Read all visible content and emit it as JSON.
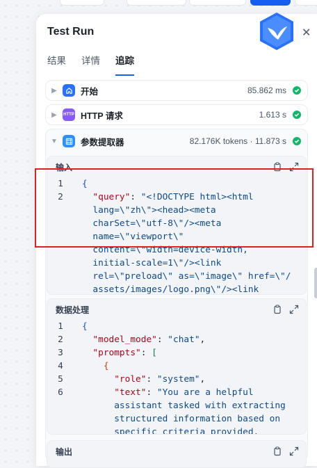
{
  "panel": {
    "title": "Test Run",
    "tabs": [
      {
        "label": "结果",
        "active": false
      },
      {
        "label": "详情",
        "active": false
      },
      {
        "label": "追踪",
        "active": true
      }
    ]
  },
  "colors": {
    "accent": "#155eef",
    "success": "#12b76a",
    "highlight": "#e02020"
  },
  "nodes": [
    {
      "name": "开始",
      "icon": "home-icon",
      "meta": "85.862 ms",
      "status": "success"
    },
    {
      "name": "HTTP 请求",
      "icon": "http-icon",
      "icon_text": "HTTP",
      "meta": "1.613 s",
      "status": "success"
    },
    {
      "name": "参数提取器",
      "icon": "parameter-extractor-icon",
      "meta": "82.176K tokens · 11.873 s",
      "status": "success"
    }
  ],
  "sections": {
    "input": {
      "label": "输入",
      "line_numbers": [
        "1",
        "2"
      ],
      "lines": [
        [
          {
            "t": "{",
            "c": "br1"
          }
        ],
        [
          {
            "t": "  \"query\"",
            "c": "key"
          },
          {
            "t": ": ",
            "c": "pun"
          },
          {
            "t": "\"<!DOCTYPE html><html",
            "c": "str"
          }
        ],
        [
          {
            "t": "  lang=\\\"zh\\\"><head><meta",
            "c": "str"
          }
        ],
        [
          {
            "t": "  charSet=\\\"utf-8\\\"/><meta",
            "c": "str"
          }
        ],
        [
          {
            "t": "  name=\\\"viewport\\\"",
            "c": "str"
          }
        ],
        [
          {
            "t": "  content=\\\"width=device-width,",
            "c": "str"
          }
        ],
        [
          {
            "t": "  initial-scale=1\\\"/><link",
            "c": "str"
          }
        ],
        [
          {
            "t": "  rel=\\\"preload\\\" as=\\\"image\\\" href=\\\"/",
            "c": "str"
          }
        ],
        [
          {
            "t": "  assets/images/logo.png\\\"/><link",
            "c": "str"
          }
        ]
      ]
    },
    "data_processing": {
      "label": "数据处理",
      "line_numbers": [
        "1",
        "2",
        "3",
        "4",
        "5",
        "6"
      ],
      "lines": [
        [
          {
            "t": "{",
            "c": "br1"
          }
        ],
        [
          {
            "t": "  \"model_mode\"",
            "c": "key"
          },
          {
            "t": ": ",
            "c": "pun"
          },
          {
            "t": "\"chat\"",
            "c": "str"
          },
          {
            "t": ",",
            "c": "pun"
          }
        ],
        [
          {
            "t": "  \"prompts\"",
            "c": "key"
          },
          {
            "t": ": ",
            "c": "pun"
          },
          {
            "t": "[",
            "c": "br2"
          }
        ],
        [
          {
            "t": "    {",
            "c": "br3"
          }
        ],
        [
          {
            "t": "      \"role\"",
            "c": "key"
          },
          {
            "t": ": ",
            "c": "pun"
          },
          {
            "t": "\"system\"",
            "c": "str"
          },
          {
            "t": ",",
            "c": "pun"
          }
        ],
        [
          {
            "t": "      \"text\"",
            "c": "key"
          },
          {
            "t": ": ",
            "c": "pun"
          },
          {
            "t": "\"You are a helpful",
            "c": "str"
          }
        ],
        [
          {
            "t": "      assistant tasked with extracting",
            "c": "str"
          }
        ],
        [
          {
            "t": "      structured information based on",
            "c": "str"
          }
        ],
        [
          {
            "t": "      specific criteria provided.",
            "c": "str"
          }
        ]
      ]
    },
    "output": {
      "label": "输出"
    }
  }
}
